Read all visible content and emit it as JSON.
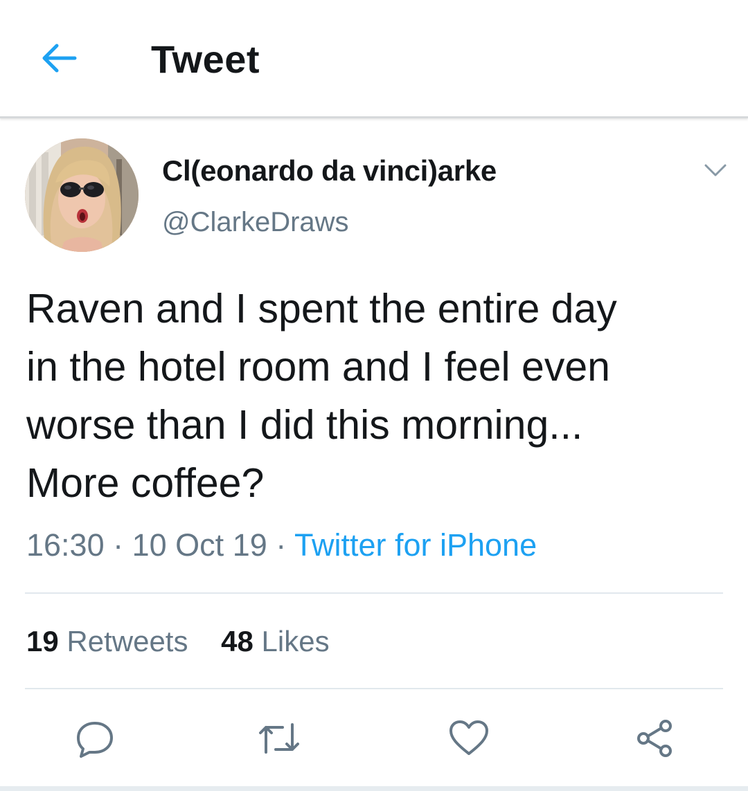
{
  "header": {
    "title": "Tweet",
    "back_icon": "arrow-left-icon",
    "accent_color": "#1da1f2"
  },
  "author": {
    "display_name": "Cl(eonardo da vinci)arke",
    "handle": "@ClarkeDraws",
    "menu_icon": "chevron-down-icon"
  },
  "tweet": {
    "text": "Raven and I spent the entire day\nin the hotel room and I feel even\nworse than I did this morning...\nMore coffee?",
    "time": "16:30",
    "separator": " · ",
    "date": "10 Oct 19",
    "source": "Twitter for iPhone"
  },
  "stats": {
    "retweets_count": "19",
    "retweets_label": "Retweets",
    "likes_count": "48",
    "likes_label": "Likes"
  },
  "actions": [
    {
      "name": "reply",
      "icon": "reply-icon"
    },
    {
      "name": "retweet",
      "icon": "retweet-icon"
    },
    {
      "name": "like",
      "icon": "heart-icon"
    },
    {
      "name": "share",
      "icon": "share-icon"
    }
  ],
  "colors": {
    "text_primary": "#14171a",
    "text_secondary": "#657786",
    "link": "#1da1f2",
    "divider": "#e1e8ed"
  }
}
